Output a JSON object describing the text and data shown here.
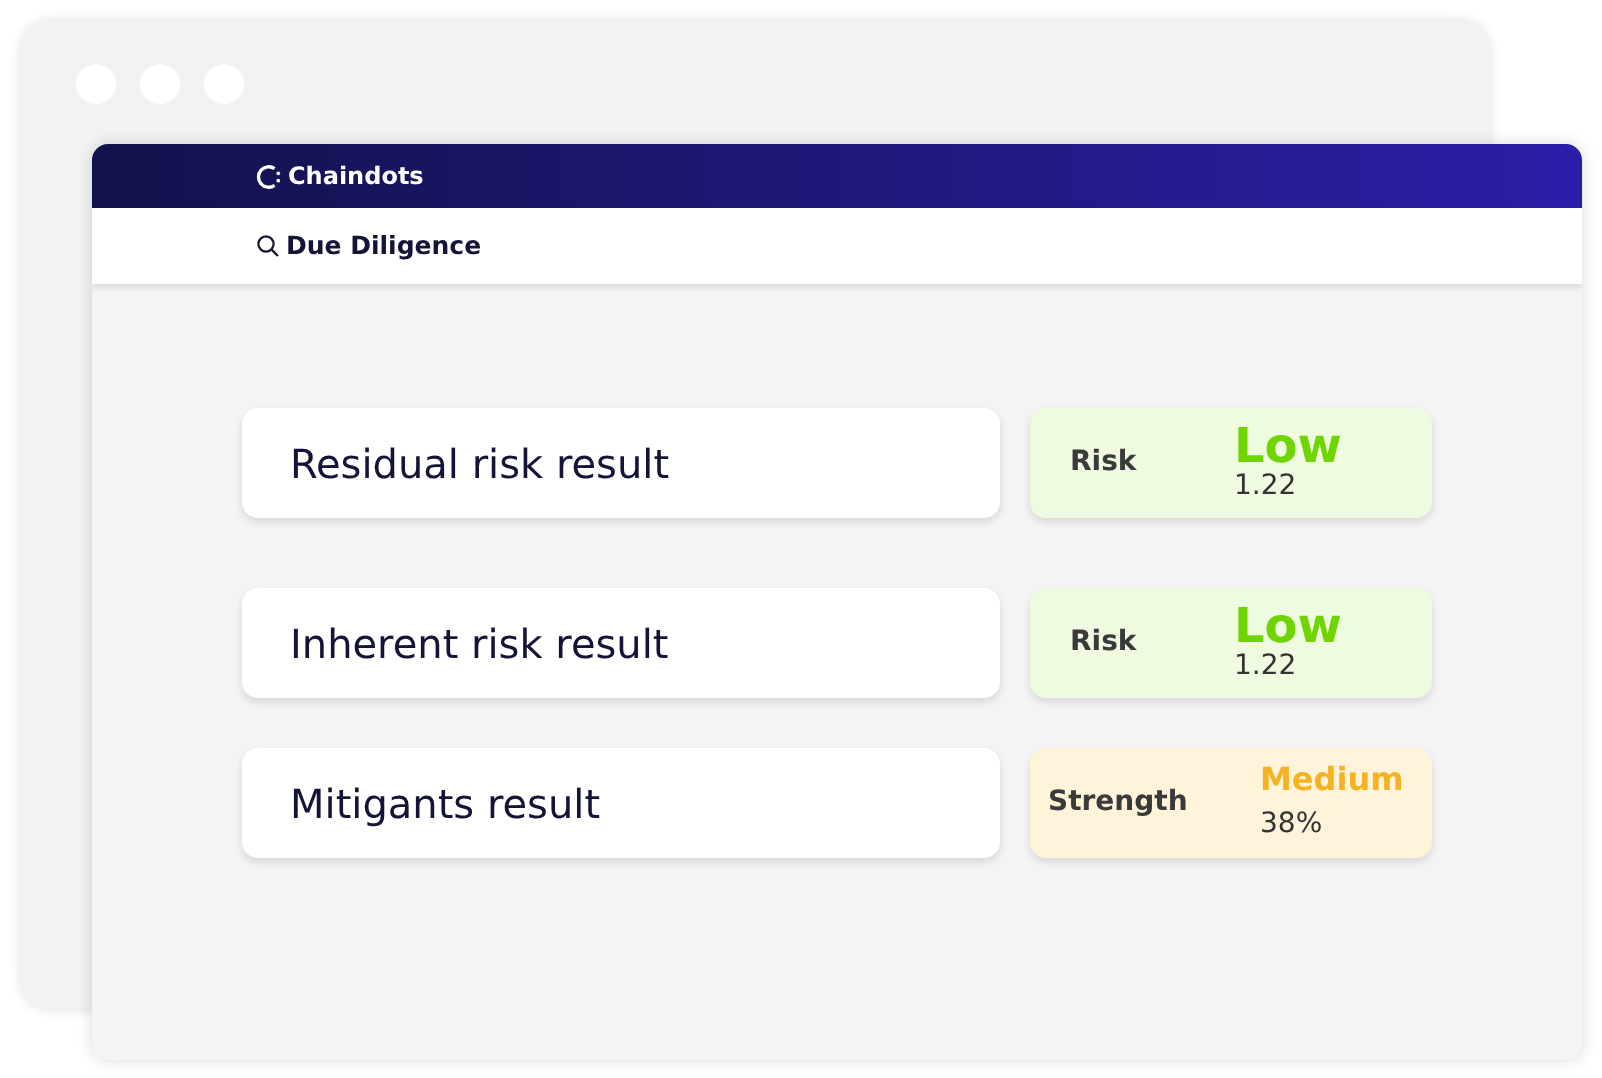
{
  "brand": {
    "name": "Chaindots"
  },
  "nav": {
    "label": "Due Diligence"
  },
  "results": [
    {
      "title": "Residual risk result",
      "metric": "Risk",
      "rating": "Low",
      "value": "1.22",
      "kind": "low"
    },
    {
      "title": "Inherent risk result",
      "metric": "Risk",
      "rating": "Low",
      "value": "1.22",
      "kind": "low"
    },
    {
      "title": "Mitigants result",
      "metric": "Strength",
      "rating": "Medium",
      "value": "38%",
      "kind": "medium"
    }
  ]
}
